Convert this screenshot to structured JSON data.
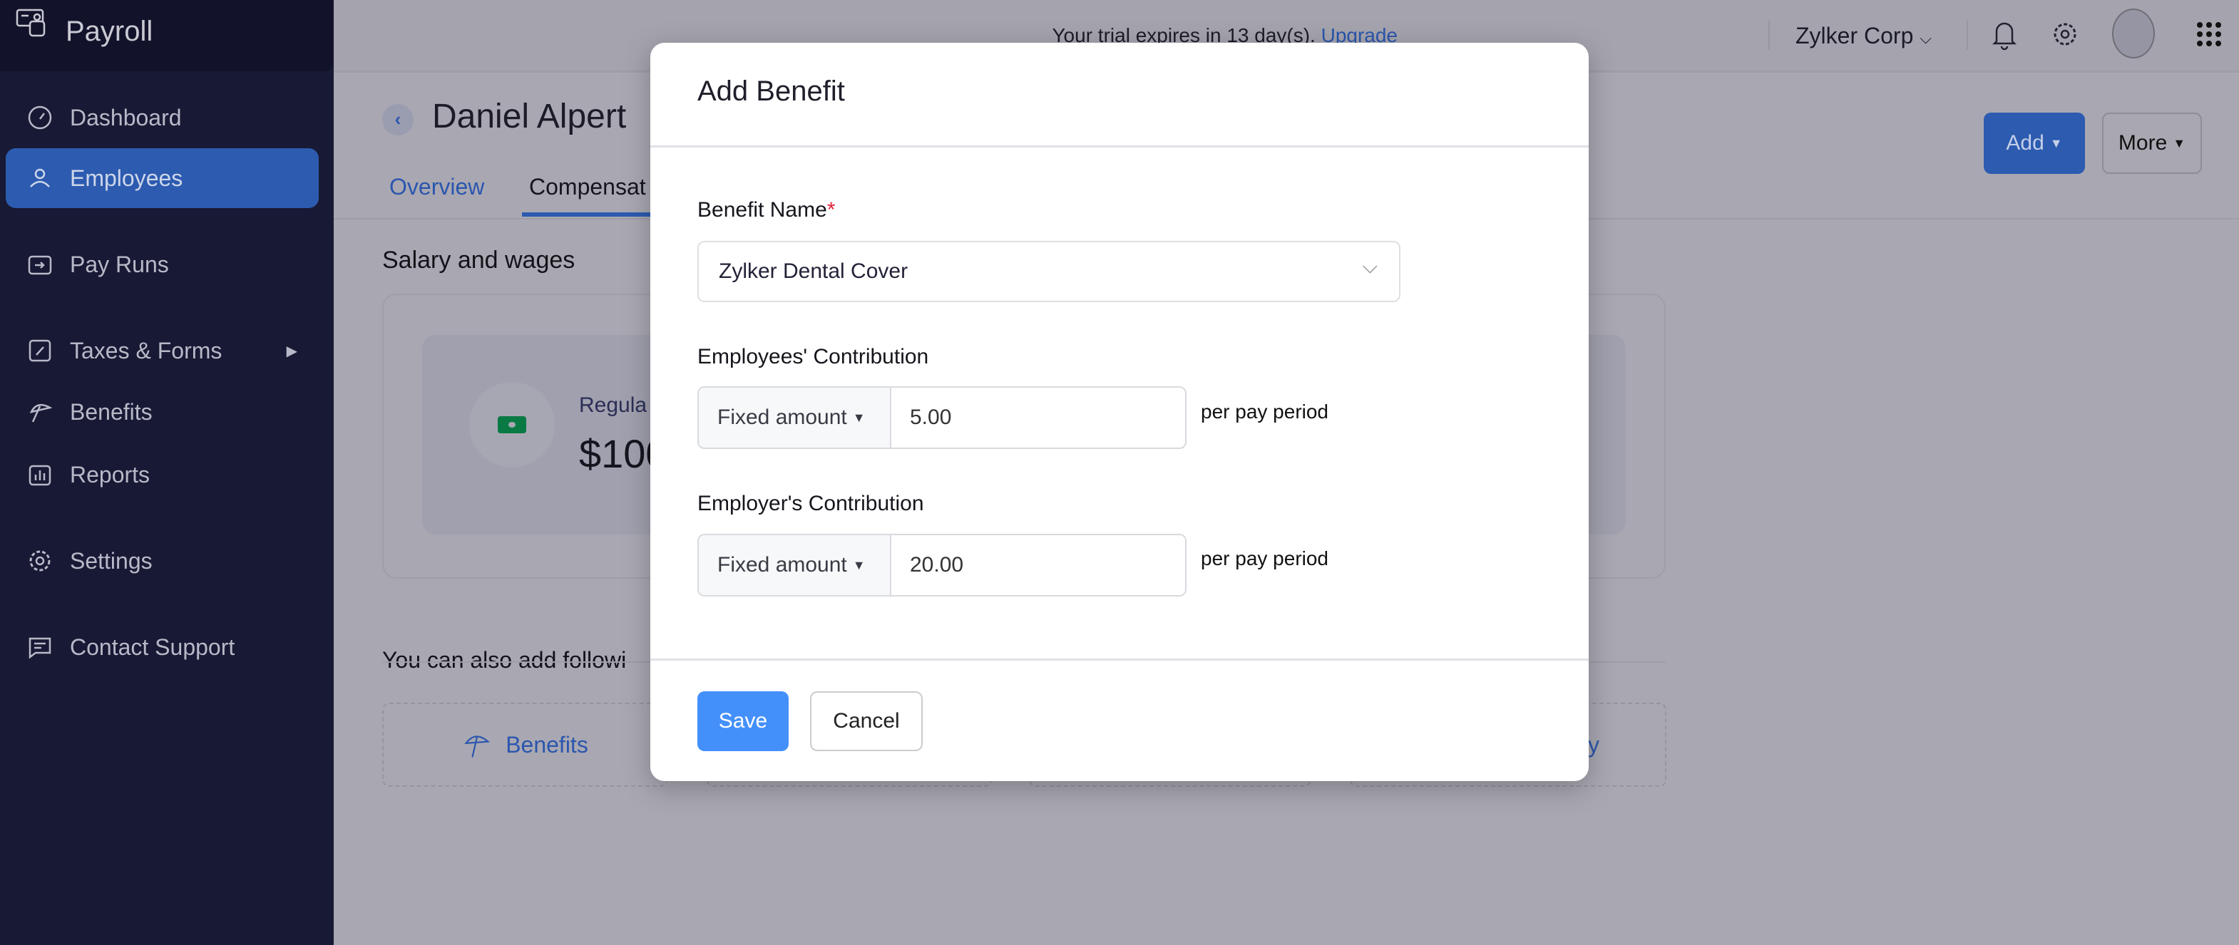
{
  "app": {
    "name": "Payroll"
  },
  "sidebar": {
    "items": [
      {
        "label": "Dashboard",
        "icon": "dashboard-gauge-icon"
      },
      {
        "label": "Employees",
        "icon": "user-icon",
        "active": true
      },
      {
        "label": "Pay Runs",
        "icon": "pay-runs-icon"
      },
      {
        "label": "Taxes & Forms",
        "icon": "taxes-icon",
        "has_submenu": true
      },
      {
        "label": "Benefits",
        "icon": "umbrella-icon"
      },
      {
        "label": "Reports",
        "icon": "bar-chart-icon"
      },
      {
        "label": "Settings",
        "icon": "gear-icon"
      },
      {
        "label": "Contact Support",
        "icon": "chat-icon"
      }
    ]
  },
  "topbar": {
    "trial_text": "Your trial expires in 13 day(s).",
    "upgrade_label": "Upgrade",
    "org_name": "Zylker Corp"
  },
  "employee": {
    "name": "Daniel Alpert",
    "tabs": [
      {
        "label": "Overview"
      },
      {
        "label": "Compensat",
        "active": true
      }
    ],
    "add_label": "Add",
    "more_label": "More"
  },
  "salary": {
    "heading": "Salary and wages",
    "regular_label": "Regula",
    "regular_amount": "$100"
  },
  "also_add": {
    "heading": "You can also add followi",
    "options": [
      {
        "label": "Benefits"
      },
      {
        "label": ""
      },
      {
        "label": ""
      },
      {
        "label": "Policy"
      }
    ]
  },
  "modal": {
    "title": "Add Benefit",
    "benefit_name_label": "Benefit Name",
    "required_mark": "*",
    "benefit_name_value": "Zylker Dental Cover",
    "employee_contribution": {
      "label": "Employees' Contribution",
      "type": "Fixed amount",
      "value": "5.00",
      "suffix": "per pay period"
    },
    "employer_contribution": {
      "label": "Employer's Contribution",
      "type": "Fixed amount",
      "value": "20.00",
      "suffix": "per pay period"
    },
    "save_label": "Save",
    "cancel_label": "Cancel"
  },
  "colors": {
    "primary": "#4490fb",
    "sidebar": "#181934",
    "active_nav": "#2c5bb0",
    "required": "#e0223c"
  }
}
